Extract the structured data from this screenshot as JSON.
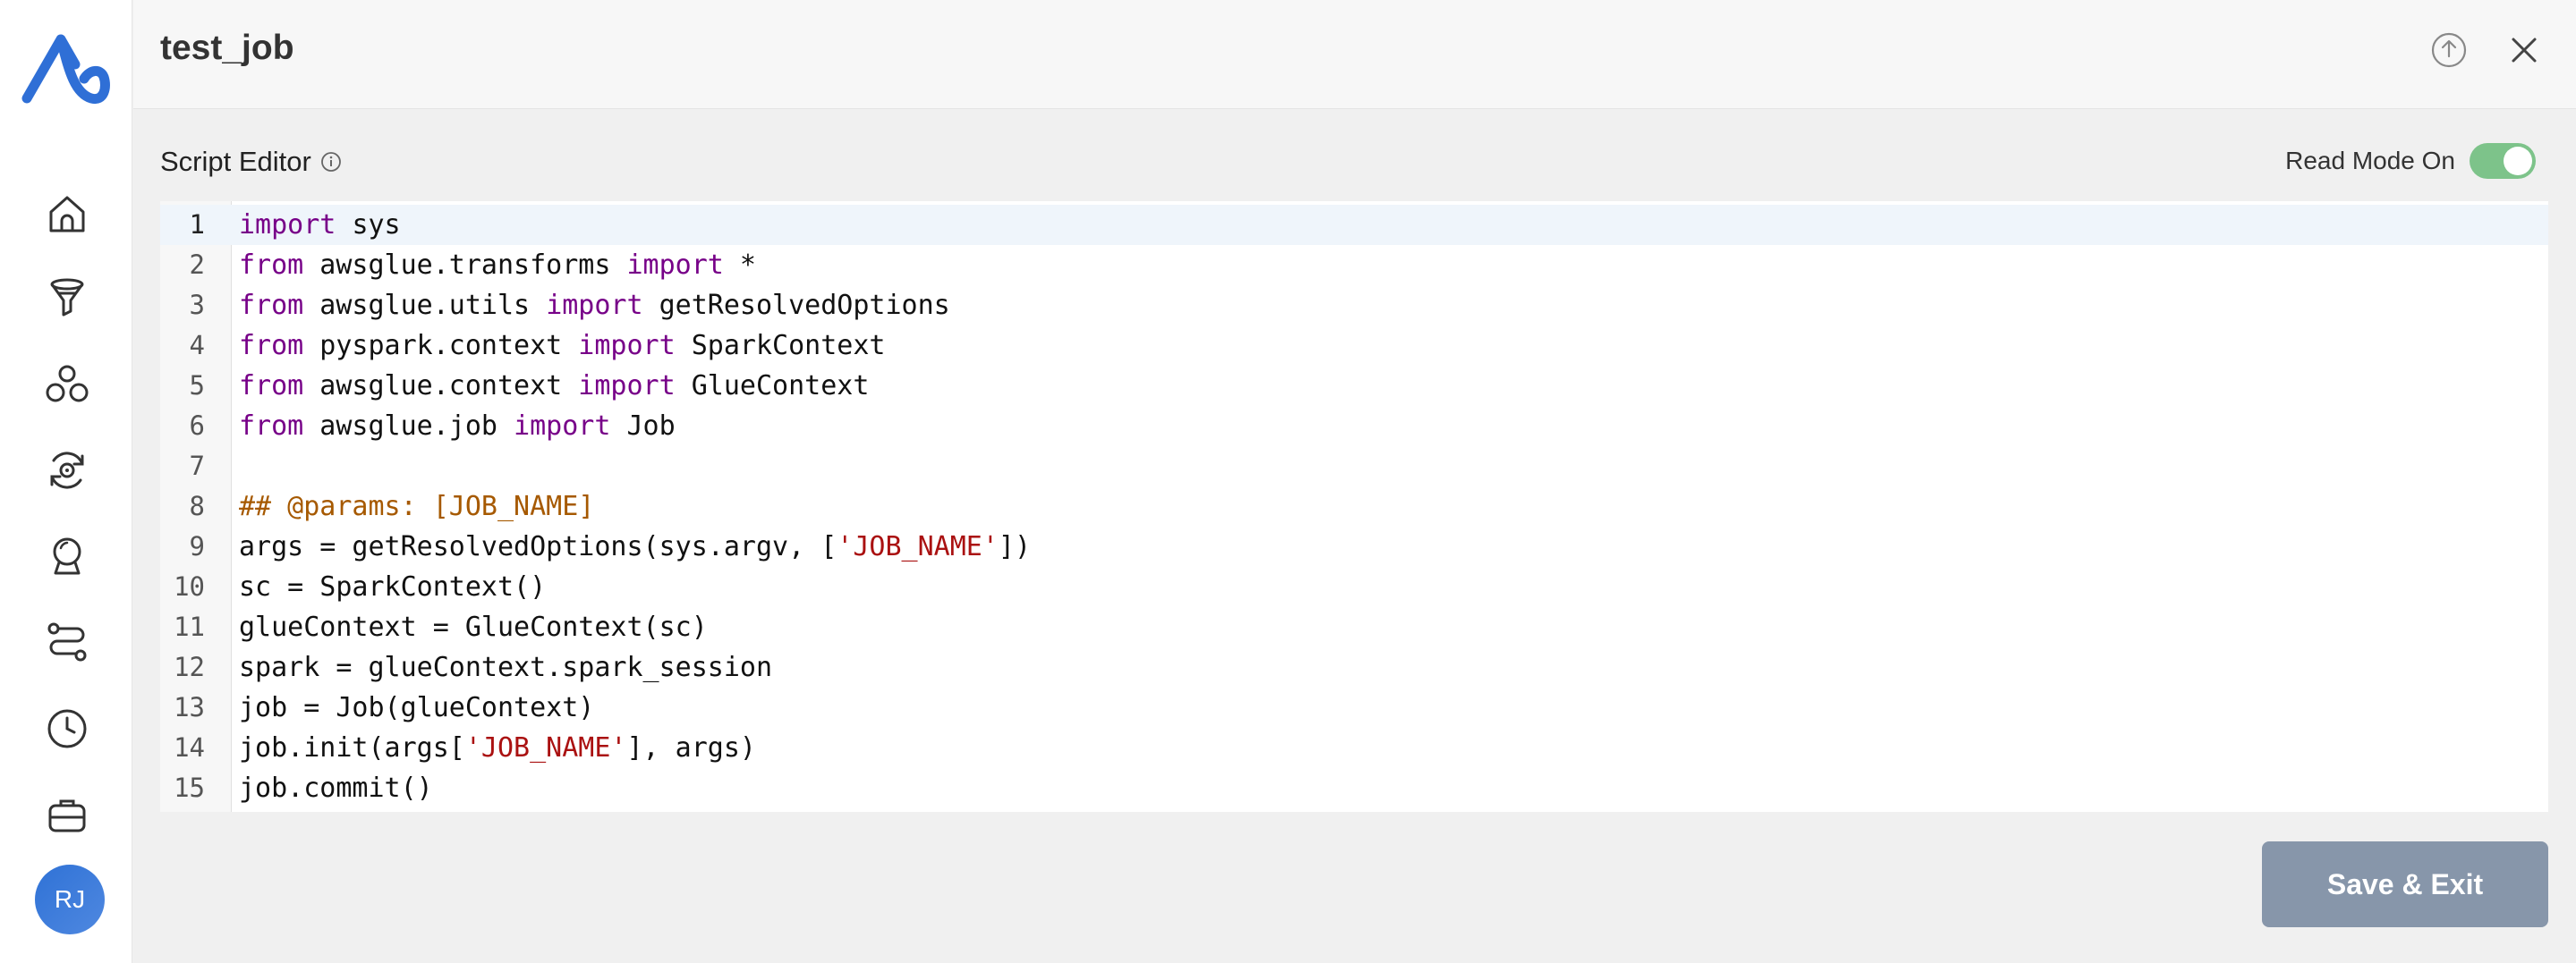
{
  "header": {
    "title": "test_job",
    "export_icon": "upload-icon",
    "close_icon": "close-icon"
  },
  "sidebar": {
    "items": [
      {
        "icon": "home-icon"
      },
      {
        "icon": "funnel-icon"
      },
      {
        "icon": "cluster-icon"
      },
      {
        "icon": "settings-cycle-icon"
      },
      {
        "icon": "crystal-ball-icon"
      },
      {
        "icon": "pipeline-icon"
      },
      {
        "icon": "clock-icon"
      },
      {
        "icon": "briefcase-icon"
      }
    ],
    "avatar_initials": "RJ"
  },
  "editor": {
    "label": "Script Editor",
    "read_mode_label": "Read Mode On",
    "read_mode_on": true,
    "lines": [
      {
        "n": "1",
        "tokens": [
          [
            "kw",
            "import"
          ],
          [
            "",
            "sys"
          ]
        ]
      },
      {
        "n": "2",
        "tokens": [
          [
            "kw",
            "from"
          ],
          [
            "",
            " awsglue.transforms "
          ],
          [
            "kw",
            "import"
          ],
          [
            "",
            " *"
          ]
        ]
      },
      {
        "n": "3",
        "tokens": [
          [
            "kw",
            "from"
          ],
          [
            "",
            " awsglue.utils "
          ],
          [
            "kw",
            "import"
          ],
          [
            "",
            " getResolvedOptions"
          ]
        ]
      },
      {
        "n": "4",
        "tokens": [
          [
            "kw",
            "from"
          ],
          [
            "",
            " pyspark.context "
          ],
          [
            "kw",
            "import"
          ],
          [
            "",
            " SparkContext"
          ]
        ]
      },
      {
        "n": "5",
        "tokens": [
          [
            "kw",
            "from"
          ],
          [
            "",
            " awsglue.context "
          ],
          [
            "kw",
            "import"
          ],
          [
            "",
            " GlueContext"
          ]
        ]
      },
      {
        "n": "6",
        "tokens": [
          [
            "kw",
            "from"
          ],
          [
            "",
            " awsglue.job "
          ],
          [
            "kw",
            "import"
          ],
          [
            "",
            " Job"
          ]
        ]
      },
      {
        "n": "7",
        "tokens": []
      },
      {
        "n": "8",
        "tokens": [
          [
            "com",
            "## @params: [JOB_NAME]"
          ]
        ]
      },
      {
        "n": "9",
        "tokens": [
          [
            "",
            "args = getResolvedOptions(sys.argv, ["
          ],
          [
            "str",
            "'JOB_NAME'"
          ],
          [
            "",
            "])"
          ]
        ]
      },
      {
        "n": "10",
        "tokens": [
          [
            "",
            "sc = SparkContext()"
          ]
        ]
      },
      {
        "n": "11",
        "tokens": [
          [
            "",
            "glueContext = GlueContext(sc)"
          ]
        ]
      },
      {
        "n": "12",
        "tokens": [
          [
            "",
            "spark = glueContext.spark_session"
          ]
        ]
      },
      {
        "n": "13",
        "tokens": [
          [
            "",
            "job = Job(glueContext)"
          ]
        ]
      },
      {
        "n": "14",
        "tokens": [
          [
            "",
            "job.init(args["
          ],
          [
            "str",
            "'JOB_NAME'"
          ],
          [
            "",
            "], args)"
          ]
        ]
      },
      {
        "n": "15",
        "tokens": [
          [
            "",
            "job.commit()"
          ]
        ]
      }
    ]
  },
  "footer": {
    "save_label": "Save & Exit"
  },
  "colors": {
    "keyword": "#770088",
    "string": "#aa1111",
    "comment": "#a65900",
    "toggle_on": "#7dc38a",
    "save_button": "#8796aa",
    "brand": "#2f6fd6"
  }
}
